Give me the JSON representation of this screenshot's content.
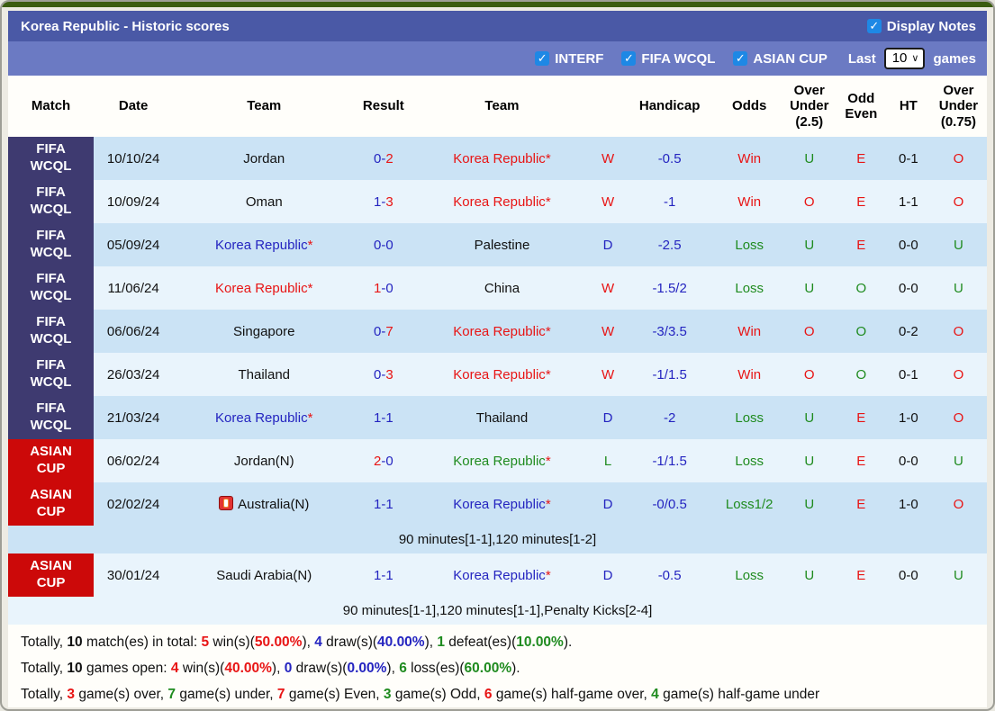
{
  "header": {
    "title": "Korea Republic - Historic scores",
    "display_notes": {
      "label": "Display Notes",
      "checked": true
    }
  },
  "filters": {
    "checkboxes": [
      {
        "label": "INTERF",
        "checked": true
      },
      {
        "label": "FIFA WCQL",
        "checked": true
      },
      {
        "label": "ASIAN CUP",
        "checked": true
      }
    ],
    "last_label": "Last",
    "last_value": "10",
    "games_label": "games"
  },
  "table": {
    "columns": [
      "Match",
      "Date",
      "Team",
      "Result",
      "Team",
      "",
      "Handicap",
      "Odds",
      "Over Under (2.5)",
      "Odd Even",
      "HT",
      "Over Under (0.75)"
    ],
    "rows": [
      {
        "competition": {
          "label": "FIFA\nWCQL",
          "type": "fifa"
        },
        "date": "10/10/24",
        "home": {
          "name": "Jordan",
          "color": "black",
          "star": false,
          "flag": false
        },
        "result": {
          "home": "0",
          "home_color": "blue",
          "away": "2",
          "away_color": "red"
        },
        "away": {
          "name": "Korea Republic",
          "color": "red",
          "star": true,
          "flag": false
        },
        "wdl": {
          "text": "W",
          "color": "red"
        },
        "handicap": "-0.5",
        "odds": {
          "text": "Win",
          "color": "red"
        },
        "over_under_25": {
          "text": "U",
          "color": "green"
        },
        "odd_even": {
          "text": "E",
          "color": "red"
        },
        "ht": "0-1",
        "over_under_075": {
          "text": "O",
          "color": "red"
        },
        "note": null
      },
      {
        "competition": {
          "label": "FIFA\nWCQL",
          "type": "fifa"
        },
        "date": "10/09/24",
        "home": {
          "name": "Oman",
          "color": "black",
          "star": false,
          "flag": false
        },
        "result": {
          "home": "1",
          "home_color": "blue",
          "away": "3",
          "away_color": "red"
        },
        "away": {
          "name": "Korea Republic",
          "color": "red",
          "star": true,
          "flag": false
        },
        "wdl": {
          "text": "W",
          "color": "red"
        },
        "handicap": "-1",
        "odds": {
          "text": "Win",
          "color": "red"
        },
        "over_under_25": {
          "text": "O",
          "color": "red"
        },
        "odd_even": {
          "text": "E",
          "color": "red"
        },
        "ht": "1-1",
        "over_under_075": {
          "text": "O",
          "color": "red"
        },
        "note": null
      },
      {
        "competition": {
          "label": "FIFA\nWCQL",
          "type": "fifa"
        },
        "date": "05/09/24",
        "home": {
          "name": "Korea Republic",
          "color": "blue",
          "star": true,
          "flag": false
        },
        "result": {
          "home": "0",
          "home_color": "blue",
          "away": "0",
          "away_color": "blue"
        },
        "away": {
          "name": "Palestine",
          "color": "black",
          "star": false,
          "flag": false
        },
        "wdl": {
          "text": "D",
          "color": "blue"
        },
        "handicap": "-2.5",
        "odds": {
          "text": "Loss",
          "color": "green"
        },
        "over_under_25": {
          "text": "U",
          "color": "green"
        },
        "odd_even": {
          "text": "E",
          "color": "red"
        },
        "ht": "0-0",
        "over_under_075": {
          "text": "U",
          "color": "green"
        },
        "note": null
      },
      {
        "competition": {
          "label": "FIFA\nWCQL",
          "type": "fifa"
        },
        "date": "11/06/24",
        "home": {
          "name": "Korea Republic",
          "color": "red",
          "star": true,
          "flag": false
        },
        "result": {
          "home": "1",
          "home_color": "red",
          "away": "0",
          "away_color": "blue"
        },
        "away": {
          "name": "China",
          "color": "black",
          "star": false,
          "flag": false
        },
        "wdl": {
          "text": "W",
          "color": "red"
        },
        "handicap": "-1.5/2",
        "odds": {
          "text": "Loss",
          "color": "green"
        },
        "over_under_25": {
          "text": "U",
          "color": "green"
        },
        "odd_even": {
          "text": "O",
          "color": "green"
        },
        "ht": "0-0",
        "over_under_075": {
          "text": "U",
          "color": "green"
        },
        "note": null
      },
      {
        "competition": {
          "label": "FIFA\nWCQL",
          "type": "fifa"
        },
        "date": "06/06/24",
        "home": {
          "name": "Singapore",
          "color": "black",
          "star": false,
          "flag": false
        },
        "result": {
          "home": "0",
          "home_color": "blue",
          "away": "7",
          "away_color": "red"
        },
        "away": {
          "name": "Korea Republic",
          "color": "red",
          "star": true,
          "flag": false
        },
        "wdl": {
          "text": "W",
          "color": "red"
        },
        "handicap": "-3/3.5",
        "odds": {
          "text": "Win",
          "color": "red"
        },
        "over_under_25": {
          "text": "O",
          "color": "red"
        },
        "odd_even": {
          "text": "O",
          "color": "green"
        },
        "ht": "0-2",
        "over_under_075": {
          "text": "O",
          "color": "red"
        },
        "note": null
      },
      {
        "competition": {
          "label": "FIFA\nWCQL",
          "type": "fifa"
        },
        "date": "26/03/24",
        "home": {
          "name": "Thailand",
          "color": "black",
          "star": false,
          "flag": false
        },
        "result": {
          "home": "0",
          "home_color": "blue",
          "away": "3",
          "away_color": "red"
        },
        "away": {
          "name": "Korea Republic",
          "color": "red",
          "star": true,
          "flag": false
        },
        "wdl": {
          "text": "W",
          "color": "red"
        },
        "handicap": "-1/1.5",
        "odds": {
          "text": "Win",
          "color": "red"
        },
        "over_under_25": {
          "text": "O",
          "color": "red"
        },
        "odd_even": {
          "text": "O",
          "color": "green"
        },
        "ht": "0-1",
        "over_under_075": {
          "text": "O",
          "color": "red"
        },
        "note": null
      },
      {
        "competition": {
          "label": "FIFA\nWCQL",
          "type": "fifa"
        },
        "date": "21/03/24",
        "home": {
          "name": "Korea Republic",
          "color": "blue",
          "star": true,
          "flag": false
        },
        "result": {
          "home": "1",
          "home_color": "blue",
          "away": "1",
          "away_color": "blue"
        },
        "away": {
          "name": "Thailand",
          "color": "black",
          "star": false,
          "flag": false
        },
        "wdl": {
          "text": "D",
          "color": "blue"
        },
        "handicap": "-2",
        "odds": {
          "text": "Loss",
          "color": "green"
        },
        "over_under_25": {
          "text": "U",
          "color": "green"
        },
        "odd_even": {
          "text": "E",
          "color": "red"
        },
        "ht": "1-0",
        "over_under_075": {
          "text": "O",
          "color": "red"
        },
        "note": null
      },
      {
        "competition": {
          "label": "ASIAN\nCUP",
          "type": "asian"
        },
        "date": "06/02/24",
        "home": {
          "name": "Jordan(N)",
          "color": "black",
          "star": false,
          "flag": false
        },
        "result": {
          "home": "2",
          "home_color": "red",
          "away": "0",
          "away_color": "blue"
        },
        "away": {
          "name": "Korea Republic",
          "color": "green",
          "star": true,
          "flag": false
        },
        "wdl": {
          "text": "L",
          "color": "green"
        },
        "handicap": "-1/1.5",
        "odds": {
          "text": "Loss",
          "color": "green"
        },
        "over_under_25": {
          "text": "U",
          "color": "green"
        },
        "odd_even": {
          "text": "E",
          "color": "red"
        },
        "ht": "0-0",
        "over_under_075": {
          "text": "U",
          "color": "green"
        },
        "note": null
      },
      {
        "competition": {
          "label": "ASIAN\nCUP",
          "type": "asian"
        },
        "date": "02/02/24",
        "home": {
          "name": "Australia(N)",
          "color": "black",
          "star": false,
          "flag": true
        },
        "result": {
          "home": "1",
          "home_color": "blue",
          "away": "1",
          "away_color": "blue"
        },
        "away": {
          "name": "Korea Republic",
          "color": "blue",
          "star": true,
          "flag": false
        },
        "wdl": {
          "text": "D",
          "color": "blue"
        },
        "handicap": "-0/0.5",
        "odds": {
          "text": "Loss1/2",
          "color": "green"
        },
        "over_under_25": {
          "text": "U",
          "color": "green"
        },
        "odd_even": {
          "text": "E",
          "color": "red"
        },
        "ht": "1-0",
        "over_under_075": {
          "text": "O",
          "color": "red"
        },
        "note": "90 minutes[1-1],120 minutes[1-2]"
      },
      {
        "competition": {
          "label": "ASIAN\nCUP",
          "type": "asian"
        },
        "date": "30/01/24",
        "home": {
          "name": "Saudi Arabia(N)",
          "color": "black",
          "star": false,
          "flag": false
        },
        "result": {
          "home": "1",
          "home_color": "blue",
          "away": "1",
          "away_color": "blue"
        },
        "away": {
          "name": "Korea Republic",
          "color": "blue",
          "star": true,
          "flag": false
        },
        "wdl": {
          "text": "D",
          "color": "blue"
        },
        "handicap": "-0.5",
        "odds": {
          "text": "Loss",
          "color": "green"
        },
        "over_under_25": {
          "text": "U",
          "color": "green"
        },
        "odd_even": {
          "text": "E",
          "color": "red"
        },
        "ht": "0-0",
        "over_under_075": {
          "text": "U",
          "color": "green"
        },
        "note": "90 minutes[1-1],120 minutes[1-1],Penalty Kicks[2-4]"
      }
    ]
  },
  "summary": [
    [
      {
        "t": "Totally, ",
        "c": "black",
        "b": false
      },
      {
        "t": "10",
        "c": "black",
        "b": true
      },
      {
        "t": " match(es) in total: ",
        "c": "black",
        "b": false
      },
      {
        "t": "5",
        "c": "red",
        "b": true
      },
      {
        "t": " win(s)(",
        "c": "black",
        "b": false
      },
      {
        "t": "50.00%",
        "c": "red",
        "b": true
      },
      {
        "t": "), ",
        "c": "black",
        "b": false
      },
      {
        "t": "4",
        "c": "blue",
        "b": true
      },
      {
        "t": " draw(s)(",
        "c": "black",
        "b": false
      },
      {
        "t": "40.00%",
        "c": "blue",
        "b": true
      },
      {
        "t": "), ",
        "c": "black",
        "b": false
      },
      {
        "t": "1",
        "c": "green",
        "b": true
      },
      {
        "t": " defeat(es)(",
        "c": "black",
        "b": false
      },
      {
        "t": "10.00%",
        "c": "green",
        "b": true
      },
      {
        "t": ").",
        "c": "black",
        "b": false
      }
    ],
    [
      {
        "t": "Totally, ",
        "c": "black",
        "b": false
      },
      {
        "t": "10",
        "c": "black",
        "b": true
      },
      {
        "t": " games open: ",
        "c": "black",
        "b": false
      },
      {
        "t": "4",
        "c": "red",
        "b": true
      },
      {
        "t": " win(s)(",
        "c": "black",
        "b": false
      },
      {
        "t": "40.00%",
        "c": "red",
        "b": true
      },
      {
        "t": "), ",
        "c": "black",
        "b": false
      },
      {
        "t": "0",
        "c": "blue",
        "b": true
      },
      {
        "t": " draw(s)(",
        "c": "black",
        "b": false
      },
      {
        "t": "0.00%",
        "c": "blue",
        "b": true
      },
      {
        "t": "), ",
        "c": "black",
        "b": false
      },
      {
        "t": "6",
        "c": "green",
        "b": true
      },
      {
        "t": " loss(es)(",
        "c": "black",
        "b": false
      },
      {
        "t": "60.00%",
        "c": "green",
        "b": true
      },
      {
        "t": ").",
        "c": "black",
        "b": false
      }
    ],
    [
      {
        "t": "Totally, ",
        "c": "black",
        "b": false
      },
      {
        "t": "3",
        "c": "red",
        "b": true
      },
      {
        "t": " game(s) over, ",
        "c": "black",
        "b": false
      },
      {
        "t": "7",
        "c": "green",
        "b": true
      },
      {
        "t": " game(s) under, ",
        "c": "black",
        "b": false
      },
      {
        "t": "7",
        "c": "red",
        "b": true
      },
      {
        "t": " game(s) Even, ",
        "c": "black",
        "b": false
      },
      {
        "t": "3",
        "c": "green",
        "b": true
      },
      {
        "t": " game(s) Odd, ",
        "c": "black",
        "b": false
      },
      {
        "t": "6",
        "c": "red",
        "b": true
      },
      {
        "t": " game(s) half-game over, ",
        "c": "black",
        "b": false
      },
      {
        "t": "4",
        "c": "green",
        "b": true
      },
      {
        "t": " game(s) half-game under",
        "c": "black",
        "b": false
      }
    ]
  ]
}
